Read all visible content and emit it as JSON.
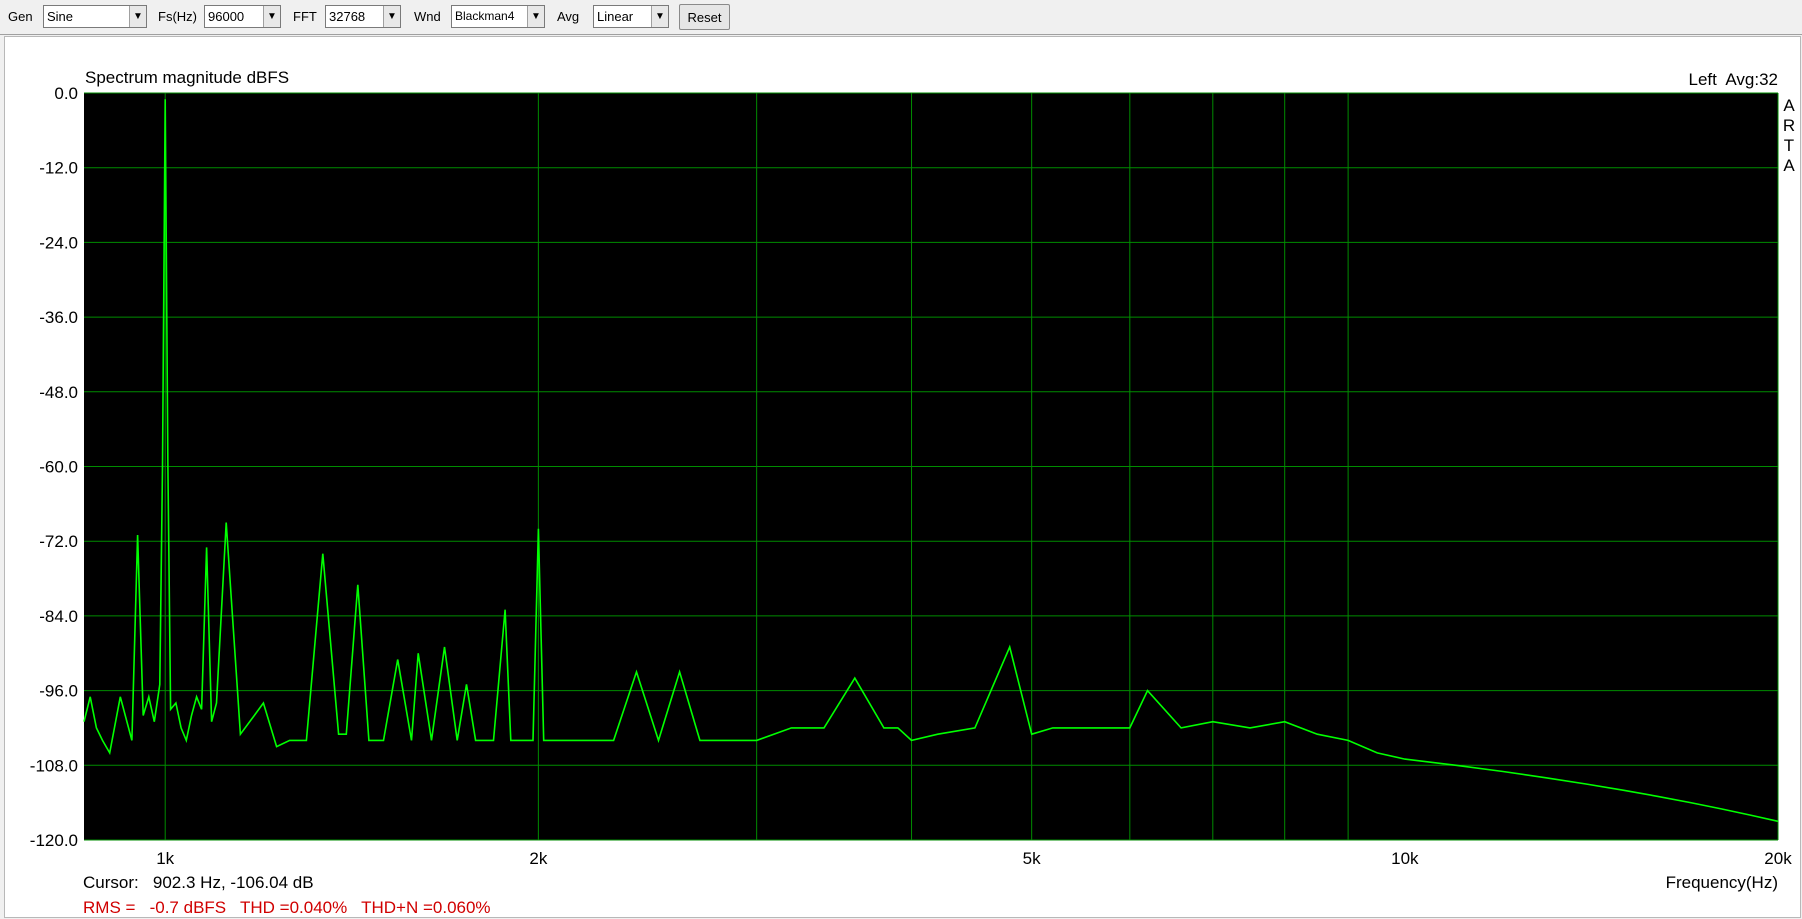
{
  "toolbar": {
    "gen_label": "Gen",
    "gen_value": "Sine",
    "fs_label": "Fs(Hz)",
    "fs_value": "96000",
    "fft_label": "FFT",
    "fft_value": "32768",
    "wnd_label": "Wnd",
    "wnd_value": "Blackman4",
    "avg_label": "Avg",
    "avg_value": "Linear",
    "reset_label": "Reset"
  },
  "plot": {
    "title": "Spectrum magnitude dBFS",
    "channel_info": "Left  Avg:32",
    "side_label": [
      "A",
      "R",
      "T",
      "A"
    ],
    "freq_axis_label": "Frequency(Hz)",
    "cursor_text": "Cursor:   902.3 Hz, -106.04 dB",
    "rms_text": "RMS =   -0.7 dBFS   THD =0.040%   THD+N =0.060%"
  },
  "colors": {
    "trace": "#00ff00",
    "grid": "#008c00",
    "background": "#000000",
    "stats": "#d00000"
  },
  "chart_data": {
    "type": "line",
    "title": "Spectrum magnitude dBFS",
    "xlabel": "Frequency(Hz)",
    "ylabel": "",
    "x_scale": "log",
    "xlim": [
      860,
      20000
    ],
    "ylim": [
      -120,
      0
    ],
    "y_ticks": [
      "0.0",
      "-12.0",
      "-24.0",
      "-36.0",
      "-48.0",
      "-60.0",
      "-72.0",
      "-84.0",
      "-96.0",
      "-108.0",
      "-120.0"
    ],
    "x_tick_labels": [
      {
        "f": 1000,
        "label": "1k"
      },
      {
        "f": 2000,
        "label": "2k"
      },
      {
        "f": 5000,
        "label": "5k"
      },
      {
        "f": 10000,
        "label": "10k"
      },
      {
        "f": 20000,
        "label": "20k"
      }
    ],
    "grid": true,
    "series": [
      {
        "x": [
          860,
          870,
          880,
          890,
          902,
          920,
          940,
          950,
          960,
          970,
          980,
          990,
          995,
          1000,
          1005,
          1010,
          1020,
          1030,
          1040,
          1050,
          1060,
          1070,
          1080,
          1090,
          1100,
          1120,
          1150,
          1180,
          1200,
          1230,
          1260,
          1300,
          1340,
          1380,
          1400,
          1430,
          1460,
          1500,
          1540,
          1580,
          1600,
          1640,
          1680,
          1720,
          1750,
          1780,
          1800,
          1840,
          1880,
          1900,
          1940,
          1960,
          1980,
          2000,
          2020,
          2050,
          2100,
          2200,
          2300,
          2400,
          2500,
          2600,
          2700,
          2800,
          3000,
          3200,
          3400,
          3600,
          3800,
          3900,
          4000,
          4200,
          4500,
          4800,
          5000,
          5200,
          5600,
          6000,
          6200,
          6600,
          7000,
          7500,
          8000,
          8500,
          9000,
          9500,
          10000,
          11000,
          12000,
          13000,
          14000,
          15000,
          16000,
          17000,
          18000,
          19000,
          20000
        ],
        "values": [
          -101,
          -97,
          -102,
          -104,
          -106,
          -97,
          -104,
          -71,
          -100,
          -97,
          -101,
          -95,
          -60,
          -1,
          -60,
          -99,
          -98,
          -102,
          -104,
          -100,
          -97,
          -99,
          -73,
          -101,
          -98,
          -69,
          -103,
          -100,
          -98,
          -105,
          -104,
          -104,
          -74,
          -103,
          -103,
          -79,
          -104,
          -104,
          -91,
          -104,
          -90,
          -104,
          -89,
          -104,
          -95,
          -104,
          -104,
          -104,
          -83,
          -104,
          -104,
          -104,
          -104,
          -70,
          -104,
          -104,
          -104,
          -104,
          -104,
          -93,
          -104,
          -93,
          -104,
          -104,
          -104,
          -102,
          -102,
          -94,
          -102,
          -102,
          -104,
          -103,
          -102,
          -89,
          -103,
          -102,
          -102,
          -102,
          -96,
          -102,
          -101,
          -102,
          -101,
          -103,
          -104,
          -106,
          -107,
          -108,
          -109,
          -110,
          -111,
          -112,
          -113,
          -114,
          -115,
          -116,
          -117
        ]
      }
    ]
  }
}
